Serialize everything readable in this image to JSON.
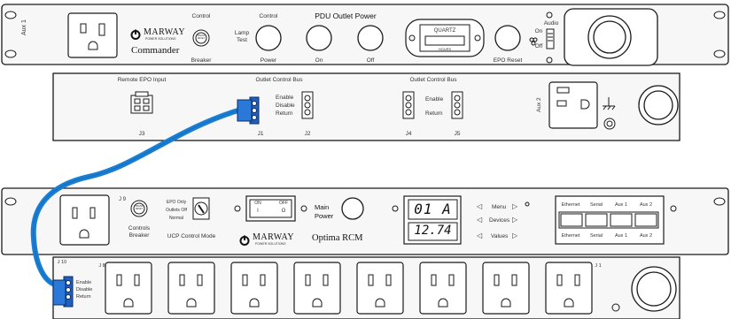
{
  "top_unit": {
    "side_label": "Aux 1",
    "brand": "MARWAY",
    "brand_sub": "POWER SOLUTIONS",
    "model": "Commander",
    "control_label": "Control",
    "breaker_label": "Breaker",
    "breaker_button": "PRESS RESET",
    "lamp_test_label": "Lamp Test",
    "control2_label": "Control",
    "power_label": "Power",
    "title": "PDU Outlet Power",
    "on_label": "On",
    "off_label": "Off",
    "hours_meter": "QUARTZ",
    "hours_label": "HOURS",
    "epo_reset_label": "EPO Reset",
    "audio_label": "Audio",
    "audio_on": "On",
    "audio_off": "Off"
  },
  "top_rear": {
    "remote_epo": "Remote EPO Input",
    "bus_left": "Outlet Control Bus",
    "bus_right": "Outlet Control Bus",
    "enable": "Enable",
    "disable": "Disable",
    "return": "Return",
    "j3": "J3",
    "j1": "J1",
    "j2": "J2",
    "j4": "J4",
    "j5": "J5",
    "aux2": "Aux 2"
  },
  "rcm_unit": {
    "j9": "J 9",
    "controls_breaker": "Controls Breaker",
    "breaker_button": "PRESS RESET",
    "epo_only": "EPO Only",
    "outlets_off": "Outlets Off",
    "normal": "Normal",
    "ucp_mode": "UCP Control Mode",
    "sw_on": "ON",
    "sw_off": "OFF",
    "main_power": "Main Power",
    "brand": "MARWAY",
    "brand_sub": "POWER SOLUTIONS",
    "model": "Optima RCM",
    "display_top": "01 A",
    "display_bottom": "12.74",
    "menu": "Menu",
    "devices": "Devices",
    "values": "Values",
    "ports": [
      "Ethernet",
      "Serial",
      "Aux 1",
      "Aux 2"
    ]
  },
  "outlet_strip": {
    "j10": "J 10",
    "j8": "J 8",
    "j1": "J 1",
    "enable": "Enable",
    "disable": "Disable",
    "return": "Return"
  },
  "colors": {
    "cable": "#1a7fd4",
    "connector": "#1f5fc0",
    "panel": "#f7f7f7",
    "line": "#1a1a1a"
  }
}
